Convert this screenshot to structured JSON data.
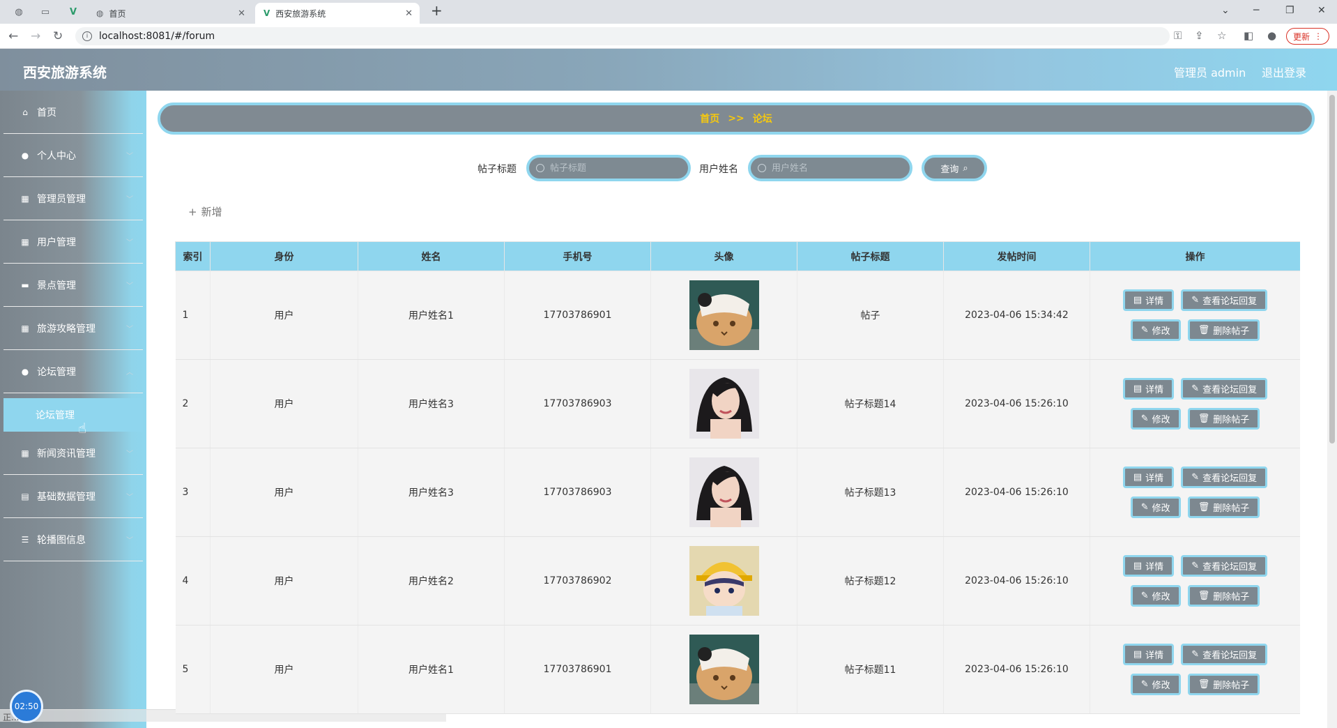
{
  "browser": {
    "tabs": [
      {
        "label": "首页"
      },
      {
        "label": "西安旅游系统"
      }
    ],
    "url": "localhost:8081/#/forum",
    "update_label": "更新"
  },
  "app": {
    "title": "西安旅游系统",
    "admin_label": "管理员 admin",
    "logout_label": "退出登录"
  },
  "sidebar": {
    "items": [
      {
        "label": "首页",
        "icon": "home-icon"
      },
      {
        "label": "个人中心",
        "icon": "user-icon"
      },
      {
        "label": "管理员管理",
        "icon": "grid-icon"
      },
      {
        "label": "用户管理",
        "icon": "grid-icon"
      },
      {
        "label": "景点管理",
        "icon": "comment-icon"
      },
      {
        "label": "旅游攻略管理",
        "icon": "grid-icon"
      },
      {
        "label": "论坛管理",
        "icon": "user-icon"
      },
      {
        "label": "新闻资讯管理",
        "icon": "grid-icon"
      },
      {
        "label": "基础数据管理",
        "icon": "printer-icon"
      },
      {
        "label": "轮播图信息",
        "icon": "list-icon"
      }
    ],
    "submenu_label": "论坛管理",
    "clock": "02:50",
    "status": "正..."
  },
  "breadcrumb": {
    "home": "首页",
    "sep": ">>",
    "current": "论坛"
  },
  "search": {
    "title_label": "帖子标题",
    "title_placeholder": "帖子标题",
    "user_label": "用户姓名",
    "user_placeholder": "用户姓名",
    "query_label": "查询"
  },
  "add_label": "新增",
  "table": {
    "headers": [
      "索引",
      "身份",
      "姓名",
      "手机号",
      "头像",
      "帖子标题",
      "发帖时间",
      "操作"
    ],
    "ops": {
      "detail": "详情",
      "view_reply": "查看论坛回复",
      "edit": "修改",
      "delete": "删除帖子"
    },
    "rows": [
      {
        "index": "1",
        "role": "用户",
        "name": "用户姓名1",
        "phone": "17703786901",
        "avatar": "cat",
        "title": "帖子",
        "time": "2023-04-06 15:34:42"
      },
      {
        "index": "2",
        "role": "用户",
        "name": "用户姓名3",
        "phone": "17703786903",
        "avatar": "woman",
        "title": "帖子标题14",
        "time": "2023-04-06 15:26:10"
      },
      {
        "index": "3",
        "role": "用户",
        "name": "用户姓名3",
        "phone": "17703786903",
        "avatar": "woman",
        "title": "帖子标题13",
        "time": "2023-04-06 15:26:10"
      },
      {
        "index": "4",
        "role": "用户",
        "name": "用户姓名2",
        "phone": "17703786902",
        "avatar": "cartoon",
        "title": "帖子标题12",
        "time": "2023-04-06 15:26:10"
      },
      {
        "index": "5",
        "role": "用户",
        "name": "用户姓名1",
        "phone": "17703786901",
        "avatar": "cat",
        "title": "帖子标题11",
        "time": "2023-04-06 15:26:10"
      }
    ]
  }
}
